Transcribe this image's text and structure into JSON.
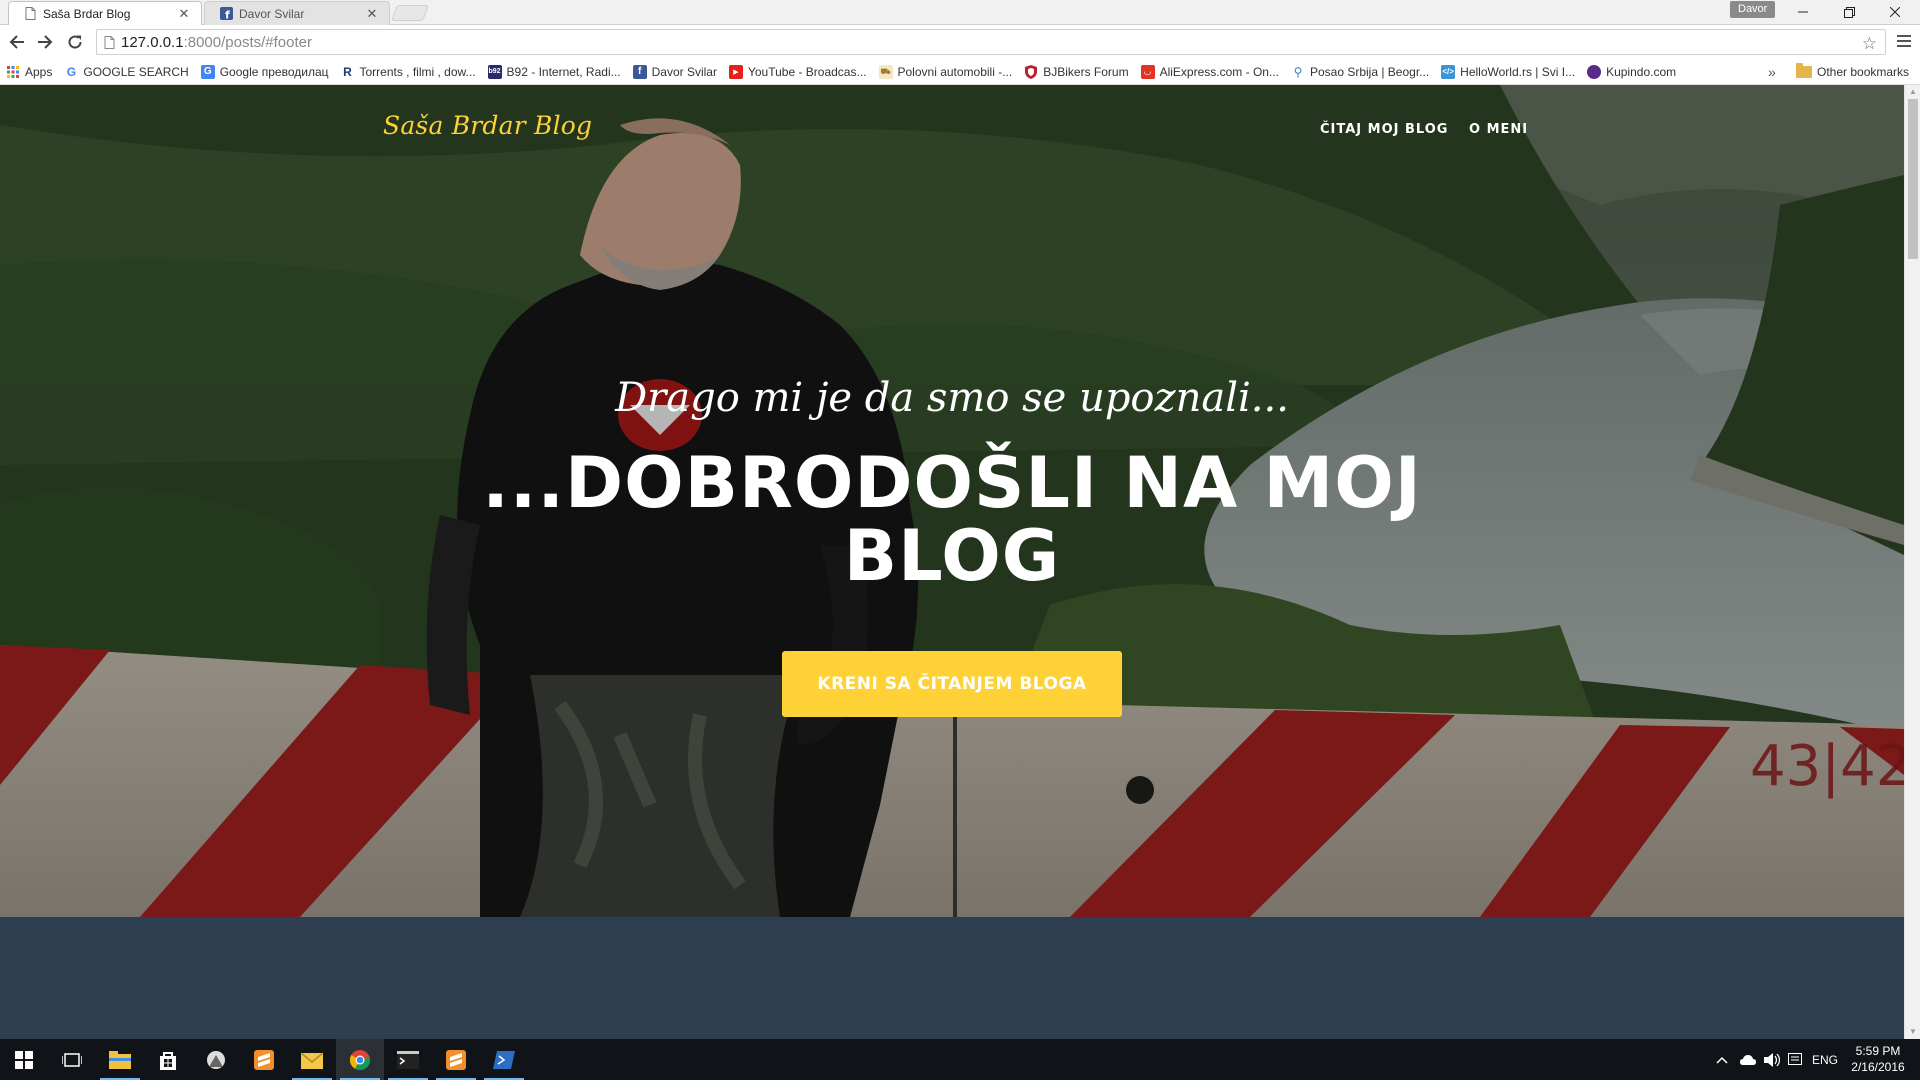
{
  "browser": {
    "tabs": [
      {
        "title": "Saša Brdar Blog",
        "active": true
      },
      {
        "title": "Davor Svilar",
        "active": false
      }
    ],
    "profile": "Davor",
    "url_host": "127.0.0.1",
    "url_path": ":8000/posts/#footer",
    "bookmarks": [
      {
        "label": "Apps",
        "icon": "apps-grid-icon"
      },
      {
        "label": "GOOGLE SEARCH",
        "icon": "google-icon"
      },
      {
        "label": "Google преводилац",
        "icon": "google-translate-icon"
      },
      {
        "label": "Torrents , filmi , dow...",
        "icon": "torrent-icon"
      },
      {
        "label": "B92 - Internet, Radi...",
        "icon": "b92-icon"
      },
      {
        "label": "Davor Svilar",
        "icon": "facebook-icon"
      },
      {
        "label": "YouTube - Broadcas...",
        "icon": "youtube-icon"
      },
      {
        "label": "Polovni automobili -...",
        "icon": "car-icon"
      },
      {
        "label": "BJBikers Forum",
        "icon": "shield-icon"
      },
      {
        "label": "AliExpress.com - On...",
        "icon": "aliexpress-icon"
      },
      {
        "label": "Posao Srbija | Beogr...",
        "icon": "job-icon"
      },
      {
        "label": "HelloWorld.rs | Svi I...",
        "icon": "helloworld-icon"
      },
      {
        "label": "Kupindo.com",
        "icon": "kupindo-icon"
      }
    ],
    "more_bookmarks": "»",
    "other_bookmarks": "Other bookmarks"
  },
  "page": {
    "brand": "Saša Brdar Blog",
    "nav": [
      "ČITAJ MOJ BLOG",
      "O MENI"
    ],
    "subheading": "Drago mi je da smo se upoznali...",
    "heading": "...DOBRODOŠLI NA MOJ BLOG",
    "cta": "KRENI SA ČITANJEM BLOGA",
    "colors": {
      "accent": "#fed136",
      "dark_section": "#2c3e50"
    }
  },
  "taskbar": {
    "apps": [
      "start-icon",
      "task-view-icon",
      "file-explorer-icon",
      "store-icon",
      "app-icon",
      "sublime-icon",
      "mail-icon",
      "chrome-icon",
      "terminal-icon",
      "sublime-icon-2",
      "powershell-icon"
    ],
    "language": "ENG",
    "time": "5:59 PM",
    "date": "2/16/2016"
  }
}
